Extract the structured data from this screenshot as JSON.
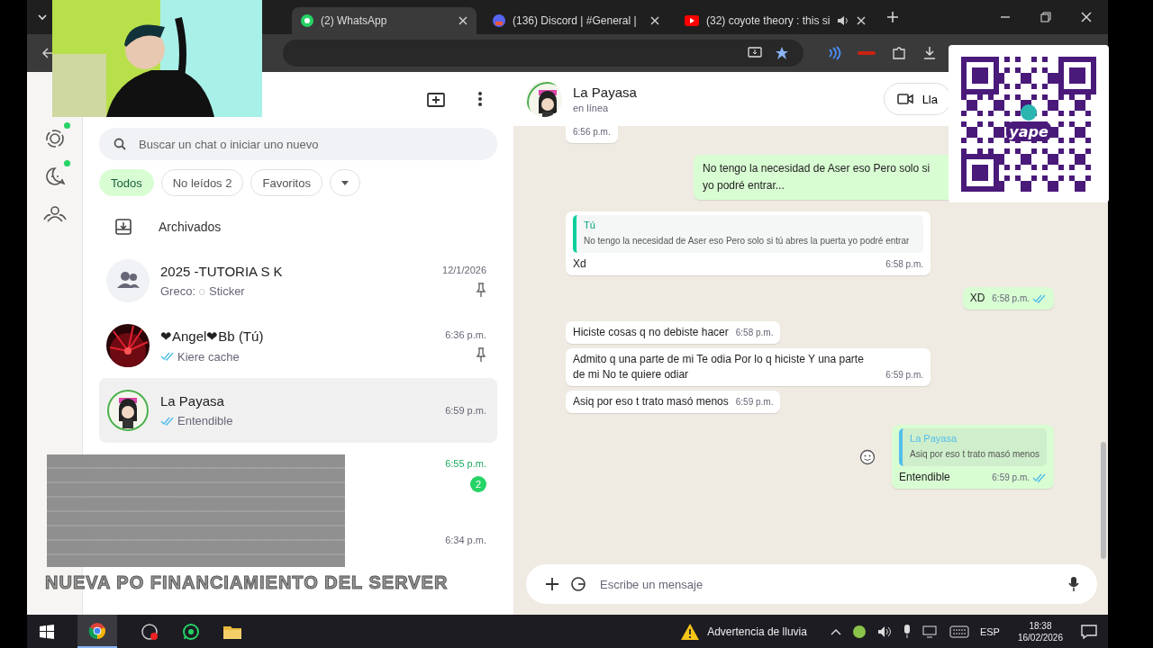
{
  "browser": {
    "tabs": [
      {
        "title": "(2) WhatsApp",
        "kind": "whatsapp",
        "selected": true,
        "audio": false
      },
      {
        "title": "(136) Discord | #General |",
        "kind": "discord",
        "selected": false,
        "audio": false
      },
      {
        "title": "(32) coyote theory : this si",
        "kind": "youtube",
        "selected": false,
        "audio": true
      }
    ]
  },
  "sidebar": {
    "items": [
      {
        "kind": "status",
        "badge": true
      },
      {
        "kind": "channels",
        "badge": true
      },
      {
        "kind": "communities",
        "badge": false
      }
    ]
  },
  "chat_list": {
    "search": {
      "placeholder": "Buscar un chat o iniciar uno nuevo"
    },
    "filters": [
      {
        "kind": "label",
        "label": "Todos",
        "selected": true
      },
      {
        "kind": "label",
        "label": "No leídos 2",
        "selected": false
      },
      {
        "kind": "label",
        "label": "Favoritos",
        "selected": false
      },
      {
        "kind": "more",
        "selected": false
      }
    ],
    "archived": {
      "label": "Archivados"
    },
    "chats": [
      {
        "kind": "group",
        "name": "2025 -TUTORIA S K",
        "preview": "Greco: ◌ Sticker",
        "time": "12/1/2026",
        "pinned": true,
        "selected": false
      },
      {
        "name": "❤Angel❤Bb (Tú)",
        "preview": "Kiere cache",
        "read": true,
        "time": "6:36 p.m.",
        "pinned": true,
        "selected": false
      },
      {
        "name": "La Payasa",
        "preview": "Entendible",
        "read": true,
        "time": "6:59 p.m.",
        "pinned": false,
        "selected": true
      },
      {
        "kind": "covered",
        "time": "6:55 p.m.",
        "unread": "2",
        "pinned": false,
        "selected": false
      },
      {
        "kind": "covered",
        "time": "6:34 p.m.",
        "pinned": false,
        "selected": false
      }
    ]
  },
  "conversation": {
    "contact": {
      "name": "La Payasa",
      "status": "en línea"
    },
    "call_label": "Lla",
    "messages": [
      {
        "kind": "in",
        "time": "6:56 p.m."
      },
      {
        "kind": "out",
        "lines": [
          "No tengo la necesidad de Aser eso Pero solo si",
          "yo podré entrar..."
        ]
      },
      {
        "kind": "in",
        "quote": {
          "author": "Tú",
          "text": "No tengo la necesidad de Aser eso Pero solo si tú abres la puerta yo podré entrar"
        },
        "text": "Xd",
        "time": "6:58 p.m."
      },
      {
        "kind": "out",
        "text": "XD",
        "time": "6:58 p.m.",
        "read": true
      },
      {
        "kind": "in",
        "text": "Hiciste cosas q no debiste hacer",
        "time": "6:58 p.m."
      },
      {
        "kind": "in",
        "text": "Admito q una parte de mi Te odia Por lo q hiciste Y una parte de mi No te quiere odiar",
        "time": "6:59 p.m."
      },
      {
        "kind": "in",
        "text": "Asiq por eso t trato masó menos",
        "time": "6:59 p.m."
      },
      {
        "kind": "out",
        "quote": {
          "author": "La Payasa",
          "text": "Asiq por eso t trato masó menos"
        },
        "text": "Entendible",
        "time": "6:59 p.m.",
        "read": true
      }
    ],
    "composer": {
      "placeholder": "Escribe un mensaje"
    }
  },
  "overlays": {
    "ticker": "NUEVA PO FINANCIAMIENTO DEL SERVER",
    "qr_label": "yape"
  },
  "taskbar": {
    "weather": "Advertencia de lluvia",
    "language": "ESP",
    "time": "18:38",
    "date": "16/02/2026"
  }
}
